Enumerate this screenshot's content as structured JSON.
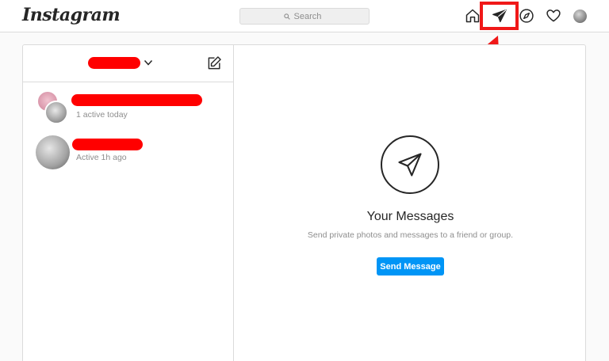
{
  "header": {
    "logo": "Instagram",
    "search": {
      "placeholder": "Search"
    },
    "nav": [
      "home-icon",
      "direct-icon",
      "explore-icon",
      "activity-icon",
      "profile-avatar"
    ]
  },
  "sidebar": {
    "threads": [
      {
        "status": "1 active today"
      },
      {
        "status": "Active 1h ago"
      }
    ]
  },
  "main": {
    "title": "Your Messages",
    "subtitle": "Send private photos and messages to a friend or group.",
    "button_label": "Send Message"
  },
  "colors": {
    "accent": "#0095f6",
    "annotation": "#f01818",
    "text": "#262626",
    "muted": "#8e8e8e",
    "border": "#dbdbdb"
  }
}
